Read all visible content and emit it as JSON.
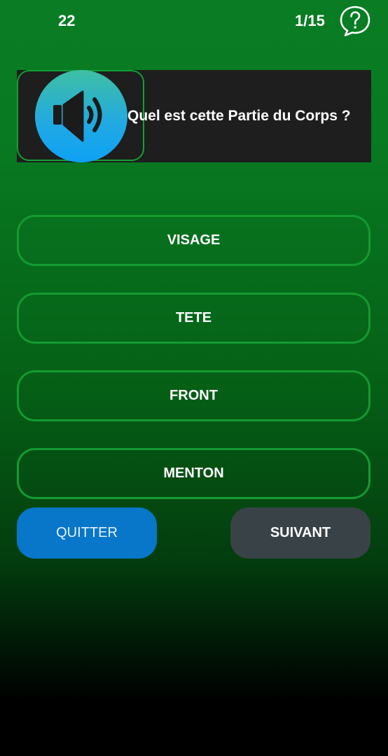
{
  "header": {
    "score": "22",
    "progress": "1/15",
    "help_icon": "question-bubble-icon"
  },
  "question": {
    "audio_icon": "speaker-icon",
    "text": "Quel est cette Partie du Corps ?"
  },
  "answers": [
    {
      "label": "VISAGE"
    },
    {
      "label": "TETE"
    },
    {
      "label": "FRONT"
    },
    {
      "label": "MENTON"
    }
  ],
  "actions": {
    "quit_label": "QUITTER",
    "next_label": "SUIVANT"
  },
  "colors": {
    "accent_green": "#13a033",
    "quit_blue": "#0876c9",
    "next_gray": "#394246"
  }
}
